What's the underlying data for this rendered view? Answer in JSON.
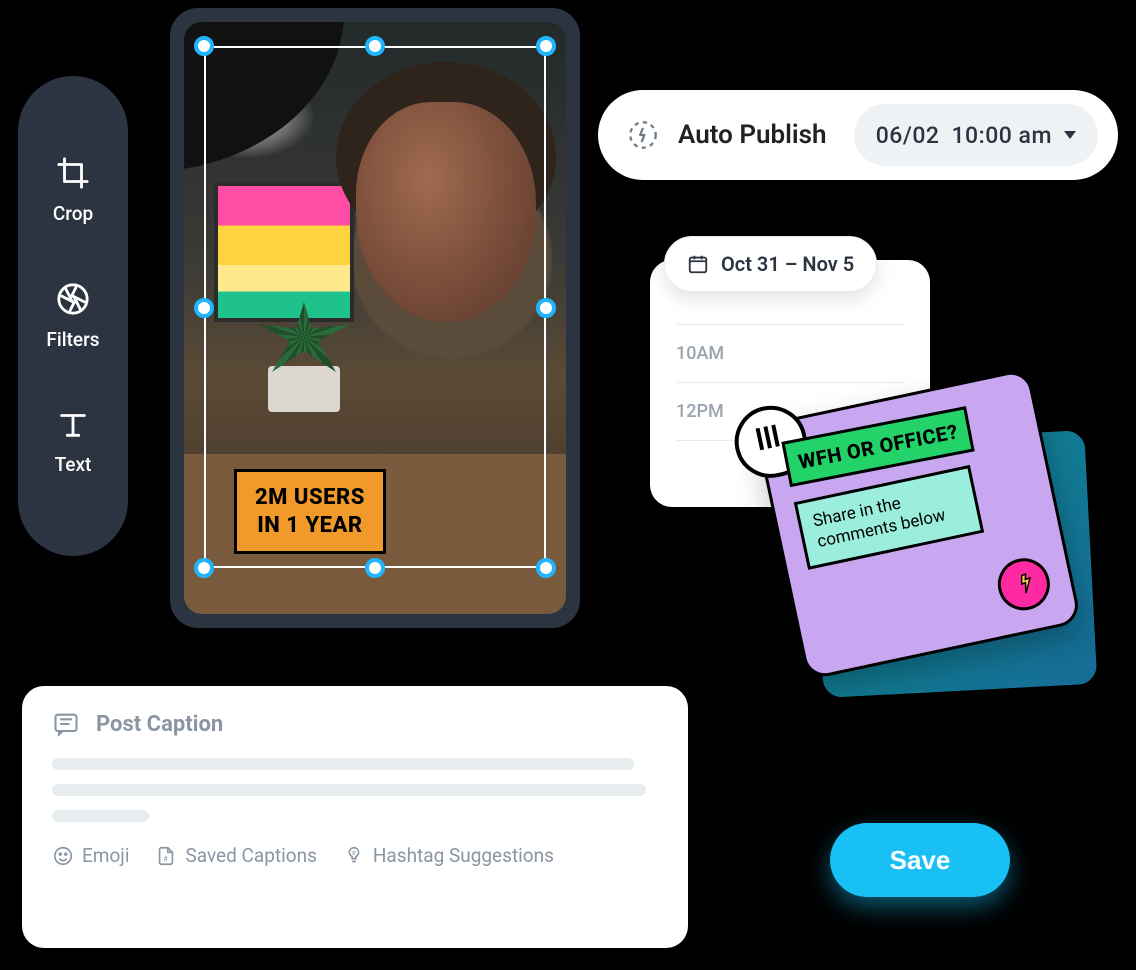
{
  "toolbar": {
    "crop": {
      "label": "Crop"
    },
    "filters": {
      "label": "Filters"
    },
    "text": {
      "label": "Text"
    }
  },
  "preview": {
    "sticker_line1": "2M USERS",
    "sticker_line2": "IN 1 YEAR"
  },
  "publish": {
    "label": "Auto Publish",
    "date": "06/02",
    "time": "10:00 am"
  },
  "calendar": {
    "range": "Oct 31 – Nov 5",
    "slots": [
      "10AM",
      "12PM"
    ]
  },
  "dragcard": {
    "headline": "WFH OR OFFICE?",
    "note": "Share in the comments below"
  },
  "caption": {
    "title": "Post Caption",
    "tools": {
      "emoji": "Emoji",
      "saved": "Saved Captions",
      "hashtag": "Hashtag Suggestions"
    }
  },
  "save_button": "Save"
}
